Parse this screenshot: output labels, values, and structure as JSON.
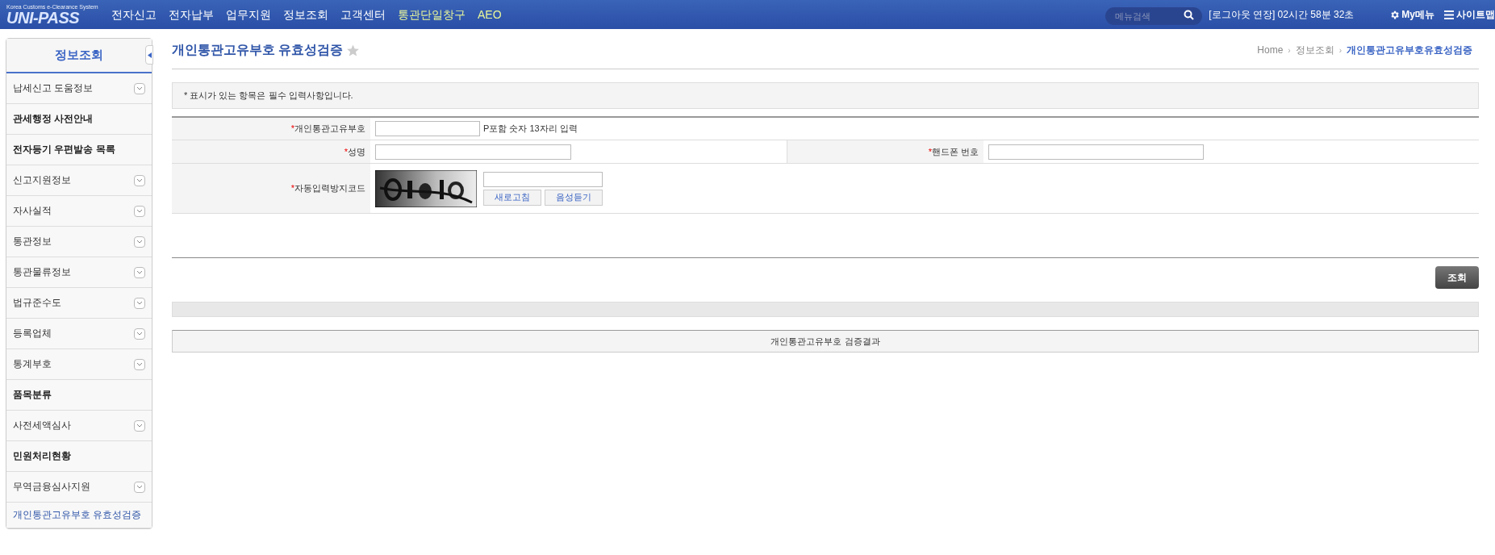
{
  "header": {
    "logo": {
      "tagline": "Korea Customs e-Clearance System",
      "name": "UNI-PASS"
    },
    "nav": [
      {
        "label": "전자신고",
        "highlight": false
      },
      {
        "label": "전자납부",
        "highlight": false
      },
      {
        "label": "업무지원",
        "highlight": false
      },
      {
        "label": "정보조회",
        "highlight": false
      },
      {
        "label": "고객센터",
        "highlight": false
      },
      {
        "label": "통관단일창구",
        "highlight": true
      },
      {
        "label": "AEO",
        "highlight": true
      }
    ],
    "search": {
      "placeholder": "메뉴검색"
    },
    "session": "[로그아웃 연장] 02시간 58분 32초",
    "my_menu": "My메뉴",
    "sitemap": "사이트맵"
  },
  "sidebar": {
    "title": "정보조회",
    "items": [
      {
        "label": "납세신고 도움정보",
        "kind": "group",
        "selected": false
      },
      {
        "label": "관세행정 사전안내",
        "kind": "link",
        "selected": false
      },
      {
        "label": "전자등기 우편발송 목록",
        "kind": "link",
        "selected": false
      },
      {
        "label": "신고지원정보",
        "kind": "group",
        "selected": false
      },
      {
        "label": "자사실적",
        "kind": "group",
        "selected": false
      },
      {
        "label": "통관정보",
        "kind": "group",
        "selected": false
      },
      {
        "label": "통관물류정보",
        "kind": "group",
        "selected": false
      },
      {
        "label": "법규준수도",
        "kind": "group",
        "selected": false
      },
      {
        "label": "등록업체",
        "kind": "group",
        "selected": false
      },
      {
        "label": "통계부호",
        "kind": "group",
        "selected": false
      },
      {
        "label": "품목분류",
        "kind": "link",
        "selected": false
      },
      {
        "label": "사전세액심사",
        "kind": "group",
        "selected": false
      },
      {
        "label": "민원처리현황",
        "kind": "link",
        "selected": false
      },
      {
        "label": "무역금융심사지원",
        "kind": "group",
        "selected": false
      },
      {
        "label": "개인통관고유부호 유효성검증",
        "kind": "link",
        "selected": true
      }
    ]
  },
  "page": {
    "title": "개인통관고유부호 유효성검증",
    "favorite": false,
    "breadcrumb": [
      "Home",
      "정보조회",
      "개인통관고유부호유효성검증"
    ],
    "breadcrumb_separator": "›",
    "notice": "* 표시가 있는 항목은 필수 입력사항입니다.",
    "form": {
      "customs_code": {
        "label": "개인통관고유부호",
        "marker": "*",
        "hint": "P포함 숫자 13자리 입력"
      },
      "name": {
        "label": "성명",
        "marker": "*"
      },
      "phone": {
        "label": "핸드폰 번호",
        "marker": "*"
      },
      "captcha": {
        "label": "자동입력방지코드",
        "marker": "*",
        "refresh": "새로고침",
        "audio": "음성듣기"
      }
    },
    "search_button": "조회",
    "result_header": "개인통관고유부호 검증결과"
  }
}
